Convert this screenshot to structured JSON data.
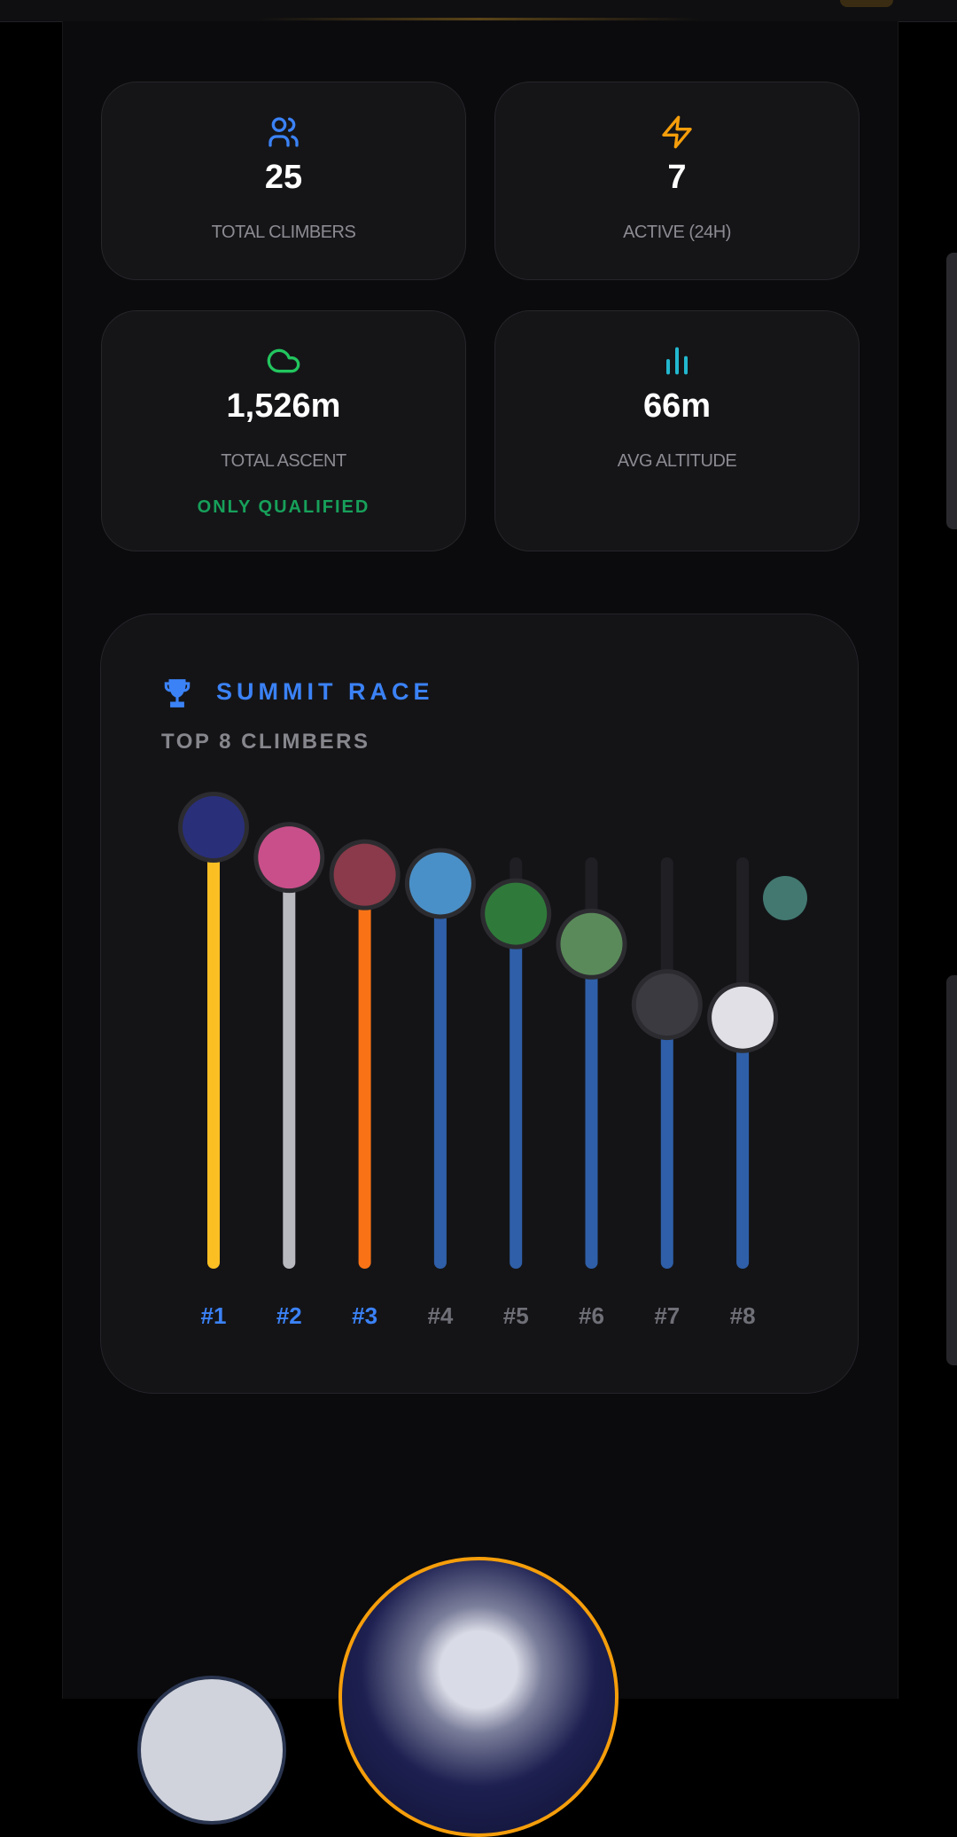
{
  "stats": [
    {
      "value": "25",
      "label": "TOTAL CLIMBERS",
      "icon": "users-icon",
      "color": "#3b82f6"
    },
    {
      "value": "7",
      "label": "ACTIVE (24H)",
      "icon": "bolt-icon",
      "color": "#f59e0b"
    },
    {
      "value": "1,526m",
      "label": "TOTAL ASCENT",
      "sub": "ONLY QUALIFIED",
      "icon": "cloud-icon",
      "color": "#22c55e"
    },
    {
      "value": "66m",
      "label": "AVG ALTITUDE",
      "icon": "bar-chart-icon",
      "color": "#22b8cf"
    }
  ],
  "race": {
    "title": "SUMMIT RACE",
    "subtitle": "TOP 8 CLIMBERS",
    "icon": "trophy-icon"
  },
  "chart_data": {
    "type": "bar",
    "categories": [
      "#1",
      "#2",
      "#3",
      "#4",
      "#5",
      "#6",
      "#7",
      "#8"
    ],
    "values": [
      1.0,
      0.93,
      0.89,
      0.87,
      0.8,
      0.73,
      0.59,
      0.56
    ],
    "bar_colors": [
      "#fbbf24",
      "#b9b9c0",
      "#f97316",
      "#2f5fa8",
      "#2f5fa8",
      "#2f5fa8",
      "#2f5fa8",
      "#2f5fa8"
    ],
    "label_colors": [
      "#3b82f6",
      "#3b82f6",
      "#3b82f6",
      "#6f6f77",
      "#6f6f77",
      "#6f6f77",
      "#6f6f77",
      "#6f6f77"
    ],
    "ylim": [
      0,
      1
    ]
  }
}
